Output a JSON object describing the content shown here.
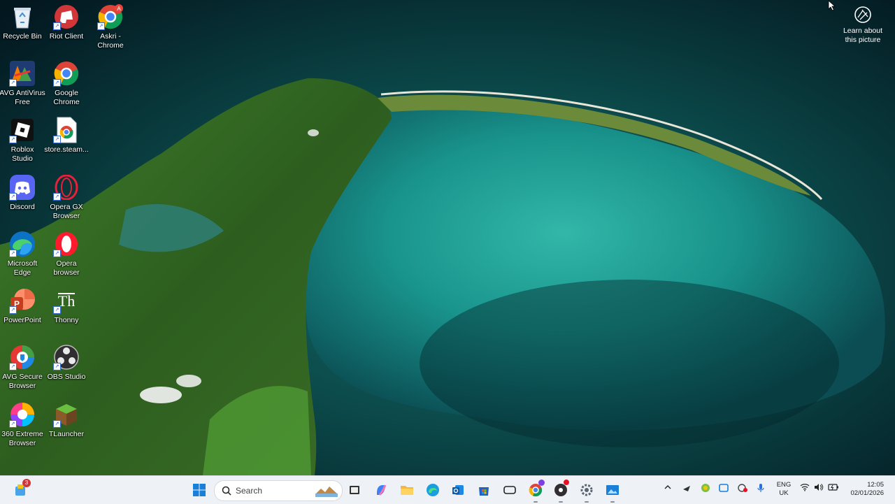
{
  "desktop": {
    "icons": [
      {
        "label": "Recycle Bin",
        "icon": "recycle-bin-icon"
      },
      {
        "label": "Riot Client",
        "icon": "riot-client-icon"
      },
      {
        "label": "Askri -\nChrome",
        "icon": "chrome-profile-icon",
        "badge": "A"
      },
      {
        "label": "AVG AntiVirus\nFree",
        "icon": "avg-antivirus-icon"
      },
      {
        "label": "Google\nChrome",
        "icon": "google-chrome-icon"
      },
      {
        "label": "Roblox\nStudio",
        "icon": "roblox-studio-icon"
      },
      {
        "label": "store.steam...",
        "icon": "chrome-document-icon"
      },
      {
        "label": "Discord",
        "icon": "discord-icon"
      },
      {
        "label": "Opera GX\nBrowser",
        "icon": "opera-gx-icon"
      },
      {
        "label": "Microsoft\nEdge",
        "icon": "microsoft-edge-icon"
      },
      {
        "label": "Opera\nbrowser",
        "icon": "opera-browser-icon"
      },
      {
        "label": "PowerPoint",
        "icon": "powerpoint-icon"
      },
      {
        "label": "Thonny",
        "icon": "thonny-icon",
        "glyph": "Th"
      },
      {
        "label": "AVG Secure\nBrowser",
        "icon": "avg-secure-browser-icon"
      },
      {
        "label": "OBS Studio",
        "icon": "obs-studio-icon"
      },
      {
        "label": "360 Extreme\nBrowser",
        "icon": "360-browser-icon"
      },
      {
        "label": "TLauncher",
        "icon": "tlauncher-icon"
      }
    ],
    "learn_about": {
      "label": "Learn about\nthis picture",
      "icon": "camera-lens-icon"
    }
  },
  "taskbar": {
    "widgets_badge": "3",
    "search_label": "Search",
    "pinned": [
      "start-icon",
      "search-highlight-icon",
      "task-view-icon",
      "copilot-icon",
      "file-explorer-icon",
      "edge-icon",
      "outlook-icon",
      "microsoft-store-icon",
      "capture-icon",
      "chrome-icon",
      "obs-icon",
      "settings-icon",
      "photos-icon"
    ],
    "tray_icons": [
      "chevron-up-icon",
      "tray-app-1-icon",
      "tray-app-2-icon",
      "tray-app-3-icon",
      "tray-app-4-icon",
      "microphone-icon"
    ],
    "language": {
      "line1": "ENG",
      "line2": "UK"
    },
    "clock": {
      "time": "12:05",
      "date": "02/01/2026"
    },
    "colors": {
      "taskbar_bg": "#eef2f6",
      "windows_blue": "#1a7fd8"
    }
  }
}
